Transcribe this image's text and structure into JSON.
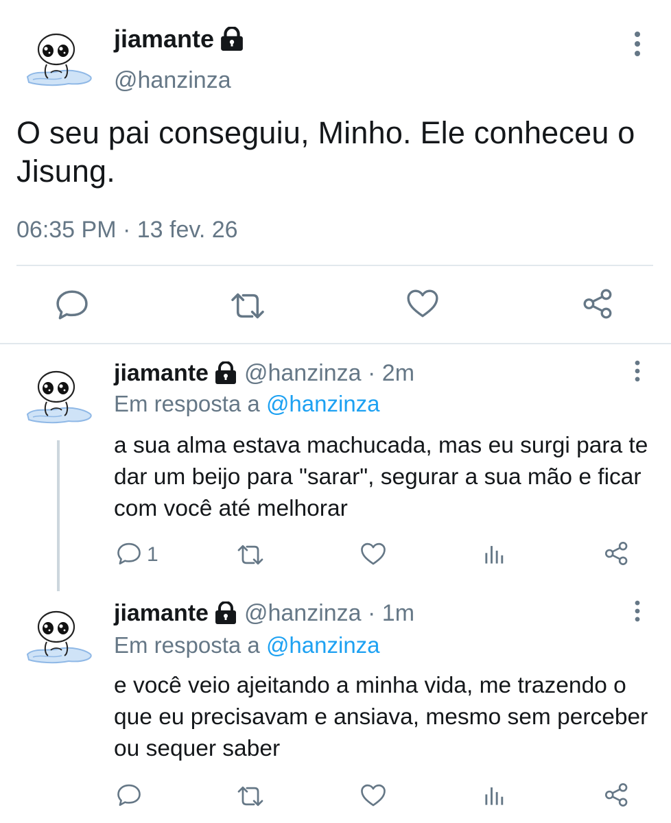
{
  "main_tweet": {
    "display_name": "jiamante",
    "handle": "@hanzinza",
    "text": "O seu pai conseguiu, Minho. Ele conheceu o Jisung.",
    "timestamp": "06:35 PM · 13 fev. 26",
    "actions": {
      "reply_icon": "comment-icon",
      "retweet_icon": "retweet-icon",
      "like_icon": "heart-icon",
      "share_icon": "share-icon"
    }
  },
  "replies": [
    {
      "display_name": "jiamante",
      "meta": "@hanzinza · 2m",
      "reply_to_prefix": "Em resposta a",
      "reply_to_handle": "@hanzinza",
      "text": "a sua alma estava machucada, mas eu surgi para te dar um beijo para \"sarar\", segurar a sua mão e ficar com você até melhorar",
      "reply_count": "1"
    },
    {
      "display_name": "jiamante",
      "meta": "@hanzinza · 1m",
      "reply_to_prefix": "Em resposta a",
      "reply_to_handle": "@hanzinza",
      "text": "e você veio ajeitando a minha vida, me trazendo o que eu precisavam e ansiava, mesmo sem perceber ou sequer saber",
      "reply_count": ""
    }
  ],
  "colors": {
    "text": "#14171a",
    "secondary": "#657786",
    "accent": "#1da1f2",
    "divider": "#e1e8ed"
  }
}
